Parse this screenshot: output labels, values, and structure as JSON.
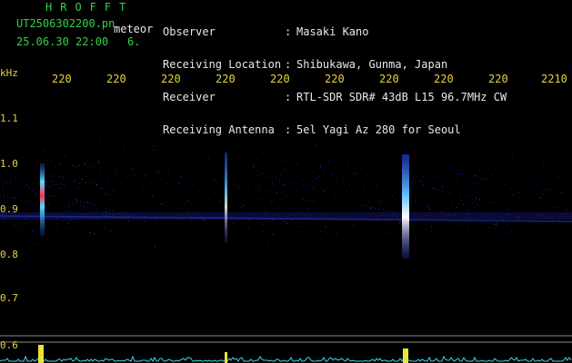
{
  "header": {
    "logo": "HROFFT",
    "filename": "UT2506302200.pn",
    "datetime": "25.06.30 22:00",
    "event_label": "meteor",
    "event_count": "6.",
    "labels": [
      "Observer",
      "Receiving Location",
      "Receiver",
      "Receiving Antenna"
    ],
    "colons": [
      ":",
      ":",
      ":",
      ":"
    ],
    "values": [
      "Masaki Kano",
      "Shibukawa, Gunma, Japan",
      "RTL-SDR SDR# 43dB L15 96.7MHz CW",
      "5el Yagi Az 280 for Seoul"
    ]
  },
  "axis": {
    "unit": "kHz",
    "x_ticks": [
      "220",
      "220",
      "220",
      "220",
      "220",
      "220",
      "220",
      "220",
      "220",
      "2210"
    ],
    "y_ticks": [
      "1.1",
      "1.0",
      "0.9",
      "0.8",
      "0.7",
      "0.6"
    ]
  },
  "colors": {
    "text_green": "#34d04a",
    "text_yellow": "#e8d23c",
    "text_white": "#e8e8e8",
    "background": "#000000",
    "signal_blue": "#2a3ccc",
    "signal_cyan": "#4ee0ff",
    "signal_red": "#ff3060",
    "baseline_cyan": "#38d6f0"
  }
}
